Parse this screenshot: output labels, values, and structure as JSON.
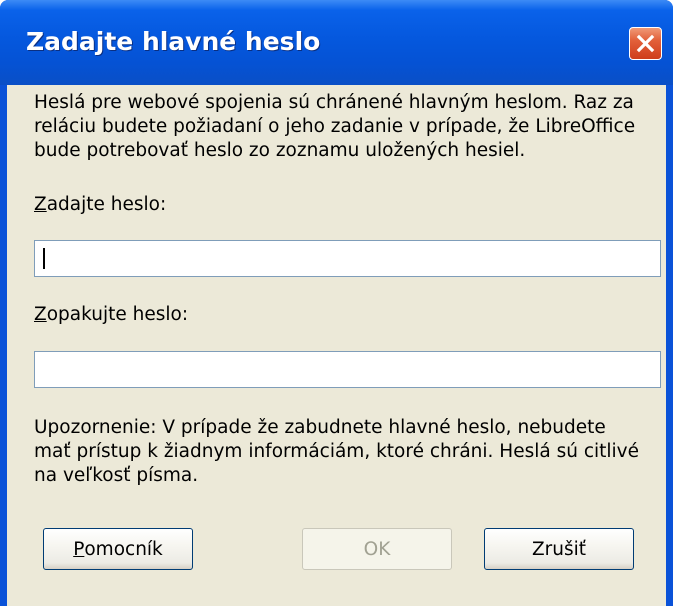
{
  "window": {
    "title": "Zadajte hlavné heslo",
    "close_icon": "close-icon"
  },
  "intro_text": "Heslá pre webové spojenia sú chránené hlavným heslom. Raz za\nreláciu budete požiadaní o jeho zadanie v prípade, že LibreOffice\nbude potrebovať heslo zo zoznamu uložených hesiel.",
  "password_field": {
    "label_accel": "Z",
    "label_rest": "adajte heslo:",
    "value": ""
  },
  "confirm_field": {
    "label_accel": "Z",
    "label_rest": "opakujte heslo:",
    "value": ""
  },
  "warning_text": "Upozornenie: V prípade že zabudnete hlavné heslo, nebudete\nmať prístup k žiadnym informáciám, ktoré chráni. Heslá sú citlivé\nna veľkosť písma.",
  "buttons": {
    "help_accel": "P",
    "help_rest": "omocník",
    "ok": "OK",
    "cancel": "Zrušiť"
  },
  "colors": {
    "titlebar": "#0558de",
    "client_bg": "#ece9d8",
    "close_button": "#d6502c",
    "input_border": "#7f9db9",
    "button_border": "#003c74"
  }
}
